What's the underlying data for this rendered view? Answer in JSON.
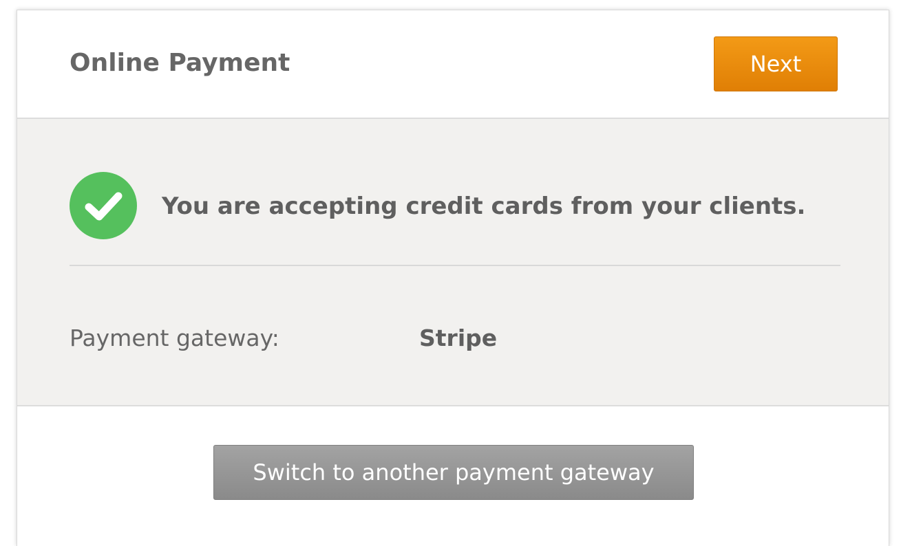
{
  "header": {
    "title": "Online Payment",
    "next_label": "Next"
  },
  "status": {
    "icon": "check-circle-icon",
    "message": "You are accepting credit cards from your clients.",
    "success_color": "#55c05d"
  },
  "gateway": {
    "label": "Payment gateway:",
    "value": "Stripe"
  },
  "actions": {
    "switch_label": "Switch to another payment gateway"
  },
  "colors": {
    "accent": "#f08c0e",
    "secondary_button": "#979797"
  }
}
